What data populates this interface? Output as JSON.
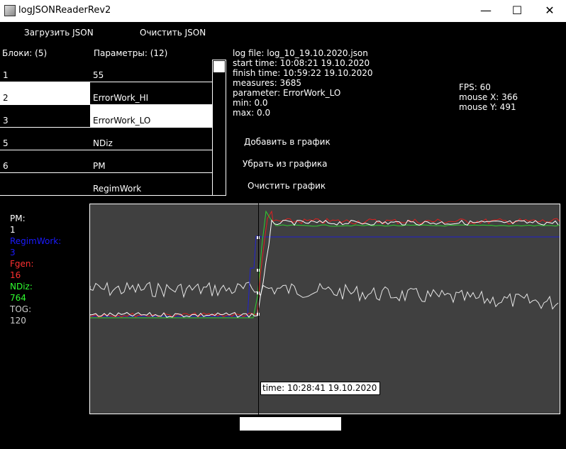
{
  "window": {
    "title": "logJSONReaderRev2",
    "minimize": "—",
    "maximize": "☐",
    "close": "✕"
  },
  "menu": {
    "load_json": "Загрузить JSON",
    "clear_json": "Очистить JSON"
  },
  "blocks": {
    "header": "Блоки: (5)",
    "items": [
      "1",
      "2",
      "3",
      "5",
      "6",
      ""
    ],
    "selected_index": 1
  },
  "params": {
    "header": "Параметры: (12)",
    "items": [
      "55",
      "ErrorWork_HI",
      "ErrorWork_LO",
      "NDiz",
      "PM",
      "RegimWork"
    ],
    "selected_index": 2
  },
  "info": {
    "log_file": "log file: log_10_19.10.2020.json",
    "start_time": "start time: 10:08:21 19.10.2020",
    "finish_time": "finish time: 10:59:22 19.10.2020",
    "measures": "measures: 3685",
    "parameter": "parameter: ErrorWork_LO",
    "min": "min: 0.0",
    "max": "max: 0.0"
  },
  "status": {
    "fps": "FPS: 60",
    "mouse_x": "mouse X: 366",
    "mouse_y": "mouse Y: 491"
  },
  "actions": {
    "add": "Добавить в график",
    "remove": "Убрать из графика",
    "clear": "Очистить график"
  },
  "legend": [
    {
      "name": "PM:",
      "value": "1",
      "color": "#ffffff"
    },
    {
      "name": "RegimWork:",
      "value": "3",
      "color": "#1a1aff"
    },
    {
      "name": "Fgen:",
      "value": "16",
      "color": "#ff3030"
    },
    {
      "name": "NDiz:",
      "value": "764",
      "color": "#30ff30"
    },
    {
      "name": "TOG:",
      "value": "120",
      "color": "#cccccc"
    }
  ],
  "tooltip": "time: 10:28:41 19.10.2020",
  "colors": {
    "plot_bg": "#404040",
    "tog": "#e6e6e6",
    "regimwork": "#2020d0",
    "fgen": "#e02020",
    "ndiz": "#30d030",
    "pm": "#ffffff"
  }
}
